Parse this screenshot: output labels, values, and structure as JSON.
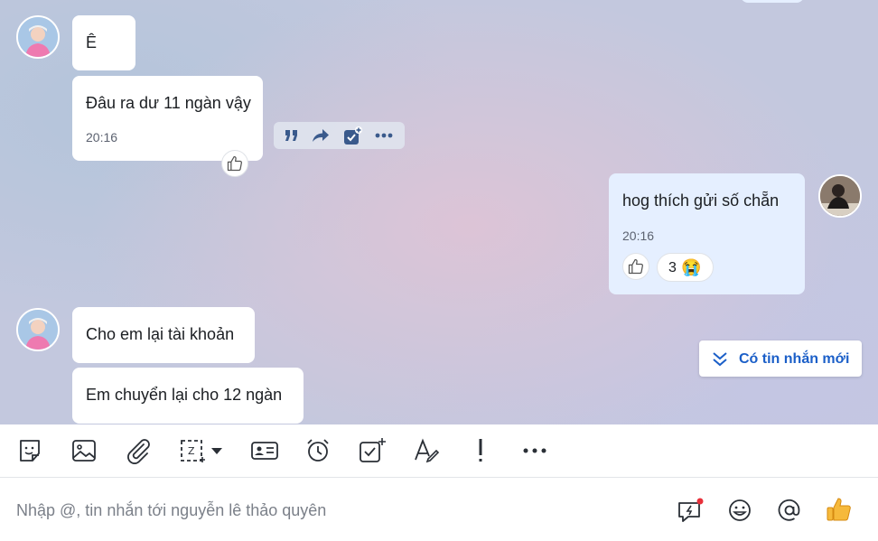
{
  "conversation": {
    "messages": [
      {
        "id": "m1",
        "side": "incoming",
        "text": "Ê"
      },
      {
        "id": "m2",
        "side": "incoming",
        "text": "Đâu ra dư 11 ngàn vậy",
        "time": "20:16"
      },
      {
        "id": "m3",
        "side": "outgoing",
        "text": "hog thích gửi số chẵn",
        "time": "20:16",
        "reaction_count": "3",
        "reaction_emoji": "😭"
      },
      {
        "id": "m4",
        "side": "incoming",
        "text": "Cho em lại tài khoản"
      },
      {
        "id": "m5",
        "side": "incoming",
        "text": "Em chuyển lại cho 12 ngàn"
      }
    ]
  },
  "new_message_banner": {
    "label": "Có tin nhắn mới"
  },
  "message_actions": [
    "quote-icon",
    "forward-icon",
    "add-task-icon",
    "more-icon"
  ],
  "toolbar": {
    "items": [
      "sticker-icon",
      "image-icon",
      "attachment-icon",
      "screenshot-icon",
      "chevron-down-icon",
      "contact-card-icon",
      "reminder-icon",
      "todo-icon",
      "text-format-icon",
      "urgent-icon",
      "more-icon"
    ]
  },
  "composer": {
    "placeholder": "Nhập @, tin nhắn tới nguyễn lê thảo quyên",
    "icons": [
      "quick-message-icon",
      "emoji-icon",
      "mention-icon",
      "thumbs-up-icon"
    ]
  },
  "colors": {
    "accent": "#1b5fc8",
    "outgoing_bubble": "#e5efff",
    "notification_dot": "#e8303a"
  }
}
